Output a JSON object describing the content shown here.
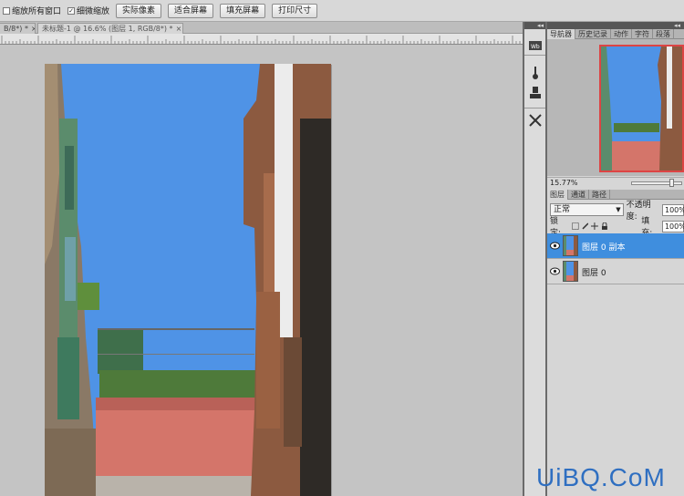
{
  "options_bar": {
    "resize_windows_label": "缩放所有窗口",
    "scrubby_zoom_label": "细微缩放",
    "scrubby_zoom_checked": true,
    "actual_pixels_label": "实际像素",
    "fit_screen_label": "适合屏幕",
    "fill_screen_label": "填充屏幕",
    "print_size_label": "打印尺寸"
  },
  "tabs": [
    {
      "label": "B/8*) *",
      "close": "×"
    },
    {
      "label": "未标题-1 @ 16.6% (图层 1, RGB/8*) *",
      "close": "×"
    }
  ],
  "navigator": {
    "tabs": [
      "导航器",
      "历史记录",
      "动作",
      "字符",
      "段落"
    ],
    "zoom": "15.77%"
  },
  "toolstrip": {
    "collapse_label": "◂◂",
    "icons": [
      "camera-raw-icon",
      "brush-tool-icon",
      "stamp-tool-icon",
      "tools-icon"
    ]
  },
  "panels_header": {
    "collapse_label": "◂◂"
  },
  "layers": {
    "tabs": [
      "图层",
      "通道",
      "路径"
    ],
    "blend_mode": "正常",
    "opacity_label": "不透明度:",
    "opacity_value": "100%",
    "lock_label": "锁定:",
    "fill_label": "填充:",
    "fill_value": "100%",
    "items": [
      {
        "name": "图层 0 副本",
        "selected": true
      },
      {
        "name": "图层 0",
        "selected": false
      }
    ]
  },
  "watermark": "UiBQ.CoM",
  "colors": {
    "selection": "#3f8ede",
    "sky": "#4f93e6",
    "navigator_frame": "#d44444"
  }
}
